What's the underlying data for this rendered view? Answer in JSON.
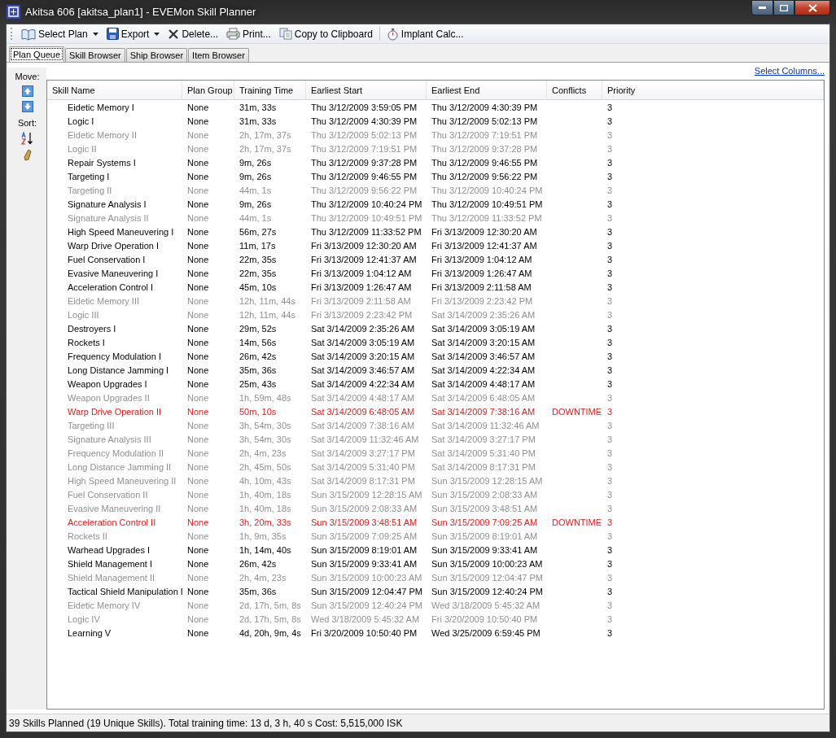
{
  "window": {
    "title": "Akitsa 606 [akitsa_plan1] - EVEMon Skill Planner"
  },
  "toolbar": [
    {
      "label": "Select Plan",
      "kind": "dropdown"
    },
    {
      "label": "Export",
      "kind": "dropdown"
    },
    {
      "label": "Delete...",
      "kind": "button"
    },
    {
      "label": "Print...",
      "kind": "button"
    },
    {
      "label": "Copy to Clipboard",
      "kind": "button"
    },
    {
      "label": "Implant Calc...",
      "kind": "button"
    }
  ],
  "tabs": [
    {
      "label": "Plan Queue",
      "selected": true
    },
    {
      "label": "Skill Browser",
      "selected": false
    },
    {
      "label": "Ship Browser",
      "selected": false
    },
    {
      "label": "Item Browser",
      "selected": false
    }
  ],
  "side_panel": {
    "move_label": "Move:",
    "sort_label": "Sort:"
  },
  "select_columns_link": "Select Columns...",
  "table": {
    "columns": [
      "Skill Name",
      "Plan Group",
      "Training Time",
      "Earliest Start",
      "Earliest End",
      "Conflicts",
      "Priority"
    ],
    "rows": [
      {
        "skill_name": "Eidetic Memory I",
        "plan_group": "None",
        "training_time": "31m, 33s",
        "earliest_start": "Thu 3/12/2009 3:59:05 PM",
        "earliest_end": "Thu 3/12/2009 4:30:39 PM",
        "priority": "3",
        "kind": "normal"
      },
      {
        "skill_name": "Logic I",
        "plan_group": "None",
        "training_time": "31m, 33s",
        "earliest_start": "Thu 3/12/2009 4:30:39 PM",
        "earliest_end": "Thu 3/12/2009 5:02:13 PM",
        "priority": "3",
        "kind": "normal"
      },
      {
        "skill_name": "Eidetic Memory II",
        "plan_group": "None",
        "training_time": "2h, 17m, 37s",
        "earliest_start": "Thu 3/12/2009 5:02:13 PM",
        "earliest_end": "Thu 3/12/2009 7:19:51 PM",
        "priority": "3",
        "kind": "dimmed"
      },
      {
        "skill_name": "Logic II",
        "plan_group": "None",
        "training_time": "2h, 17m, 37s",
        "earliest_start": "Thu 3/12/2009 7:19:51 PM",
        "earliest_end": "Thu 3/12/2009 9:37:28 PM",
        "priority": "3",
        "kind": "dimmed"
      },
      {
        "skill_name": "Repair Systems I",
        "plan_group": "None",
        "training_time": "9m, 26s",
        "earliest_start": "Thu 3/12/2009 9:37:28 PM",
        "earliest_end": "Thu 3/12/2009 9:46:55 PM",
        "priority": "3",
        "kind": "normal"
      },
      {
        "skill_name": "Targeting I",
        "plan_group": "None",
        "training_time": "9m, 26s",
        "earliest_start": "Thu 3/12/2009 9:46:55 PM",
        "earliest_end": "Thu 3/12/2009 9:56:22 PM",
        "priority": "3",
        "kind": "normal"
      },
      {
        "skill_name": "Targeting II",
        "plan_group": "None",
        "training_time": "44m, 1s",
        "earliest_start": "Thu 3/12/2009 9:56:22 PM",
        "earliest_end": "Thu 3/12/2009 10:40:24 PM",
        "priority": "3",
        "kind": "dimmed"
      },
      {
        "skill_name": "Signature Analysis I",
        "plan_group": "None",
        "training_time": "9m, 26s",
        "earliest_start": "Thu 3/12/2009 10:40:24 PM",
        "earliest_end": "Thu 3/12/2009 10:49:51 PM",
        "priority": "3",
        "kind": "normal"
      },
      {
        "skill_name": "Signature Analysis II",
        "plan_group": "None",
        "training_time": "44m, 1s",
        "earliest_start": "Thu 3/12/2009 10:49:51 PM",
        "earliest_end": "Thu 3/12/2009 11:33:52 PM",
        "priority": "3",
        "kind": "dimmed"
      },
      {
        "skill_name": "High Speed Maneuvering I",
        "plan_group": "None",
        "training_time": "56m, 27s",
        "earliest_start": "Thu 3/12/2009 11:33:52 PM",
        "earliest_end": "Fri 3/13/2009 12:30:20 AM",
        "priority": "3",
        "kind": "normal"
      },
      {
        "skill_name": "Warp Drive Operation I",
        "plan_group": "None",
        "training_time": "11m, 17s",
        "earliest_start": "Fri 3/13/2009 12:30:20 AM",
        "earliest_end": "Fri 3/13/2009 12:41:37 AM",
        "priority": "3",
        "kind": "normal"
      },
      {
        "skill_name": "Fuel Conservation I",
        "plan_group": "None",
        "training_time": "22m, 35s",
        "earliest_start": "Fri 3/13/2009 12:41:37 AM",
        "earliest_end": "Fri 3/13/2009 1:04:12 AM",
        "priority": "3",
        "kind": "normal"
      },
      {
        "skill_name": "Evasive Maneuvering I",
        "plan_group": "None",
        "training_time": "22m, 35s",
        "earliest_start": "Fri 3/13/2009 1:04:12 AM",
        "earliest_end": "Fri 3/13/2009 1:26:47 AM",
        "priority": "3",
        "kind": "normal"
      },
      {
        "skill_name": "Acceleration Control I",
        "plan_group": "None",
        "training_time": "45m, 10s",
        "earliest_start": "Fri 3/13/2009 1:26:47 AM",
        "earliest_end": "Fri 3/13/2009 2:11:58 AM",
        "priority": "3",
        "kind": "normal"
      },
      {
        "skill_name": "Eidetic Memory III",
        "plan_group": "None",
        "training_time": "12h, 11m, 44s",
        "earliest_start": "Fri 3/13/2009 2:11:58 AM",
        "earliest_end": "Fri 3/13/2009 2:23:42 PM",
        "priority": "3",
        "kind": "dimmed"
      },
      {
        "skill_name": "Logic III",
        "plan_group": "None",
        "training_time": "12h, 11m, 44s",
        "earliest_start": "Fri 3/13/2009 2:23:42 PM",
        "earliest_end": "Sat 3/14/2009 2:35:26 AM",
        "priority": "3",
        "kind": "dimmed"
      },
      {
        "skill_name": "Destroyers I",
        "plan_group": "None",
        "training_time": "29m, 52s",
        "earliest_start": "Sat 3/14/2009 2:35:26 AM",
        "earliest_end": "Sat 3/14/2009 3:05:19 AM",
        "priority": "3",
        "kind": "normal"
      },
      {
        "skill_name": "Rockets I",
        "plan_group": "None",
        "training_time": "14m, 56s",
        "earliest_start": "Sat 3/14/2009 3:05:19 AM",
        "earliest_end": "Sat 3/14/2009 3:20:15 AM",
        "priority": "3",
        "kind": "normal"
      },
      {
        "skill_name": "Frequency Modulation I",
        "plan_group": "None",
        "training_time": "26m, 42s",
        "earliest_start": "Sat 3/14/2009 3:20:15 AM",
        "earliest_end": "Sat 3/14/2009 3:46:57 AM",
        "priority": "3",
        "kind": "normal"
      },
      {
        "skill_name": "Long Distance Jamming I",
        "plan_group": "None",
        "training_time": "35m, 36s",
        "earliest_start": "Sat 3/14/2009 3:46:57 AM",
        "earliest_end": "Sat 3/14/2009 4:22:34 AM",
        "priority": "3",
        "kind": "normal"
      },
      {
        "skill_name": "Weapon Upgrades I",
        "plan_group": "None",
        "training_time": "25m, 43s",
        "earliest_start": "Sat 3/14/2009 4:22:34 AM",
        "earliest_end": "Sat 3/14/2009 4:48:17 AM",
        "priority": "3",
        "kind": "normal"
      },
      {
        "skill_name": "Weapon Upgrades II",
        "plan_group": "None",
        "training_time": "1h, 59m, 48s",
        "earliest_start": "Sat 3/14/2009 4:48:17 AM",
        "earliest_end": "Sat 3/14/2009 6:48:05 AM",
        "priority": "3",
        "kind": "dimmed"
      },
      {
        "skill_name": "Warp Drive Operation II",
        "plan_group": "None",
        "training_time": "50m, 10s",
        "earliest_start": "Sat 3/14/2009 6:48:05 AM",
        "earliest_end": "Sat 3/14/2009 7:38:16 AM",
        "conflicts": "DOWNTIME",
        "priority": "3",
        "kind": "conflict"
      },
      {
        "skill_name": "Targeting III",
        "plan_group": "None",
        "training_time": "3h, 54m, 30s",
        "earliest_start": "Sat 3/14/2009 7:38:16 AM",
        "earliest_end": "Sat 3/14/2009 11:32:46 AM",
        "priority": "3",
        "kind": "dimmed"
      },
      {
        "skill_name": "Signature Analysis III",
        "plan_group": "None",
        "training_time": "3h, 54m, 30s",
        "earliest_start": "Sat 3/14/2009 11:32:46 AM",
        "earliest_end": "Sat 3/14/2009 3:27:17 PM",
        "priority": "3",
        "kind": "dimmed"
      },
      {
        "skill_name": "Frequency Modulation II",
        "plan_group": "None",
        "training_time": "2h, 4m, 23s",
        "earliest_start": "Sat 3/14/2009 3:27:17 PM",
        "earliest_end": "Sat 3/14/2009 5:31:40 PM",
        "priority": "3",
        "kind": "dimmed"
      },
      {
        "skill_name": "Long Distance Jamming II",
        "plan_group": "None",
        "training_time": "2h, 45m, 50s",
        "earliest_start": "Sat 3/14/2009 5:31:40 PM",
        "earliest_end": "Sat 3/14/2009 8:17:31 PM",
        "priority": "3",
        "kind": "dimmed"
      },
      {
        "skill_name": "High Speed Maneuvering II",
        "plan_group": "None",
        "training_time": "4h, 10m, 43s",
        "earliest_start": "Sat 3/14/2009 8:17:31 PM",
        "earliest_end": "Sun 3/15/2009 12:28:15 AM",
        "priority": "3",
        "kind": "dimmed"
      },
      {
        "skill_name": "Fuel Conservation II",
        "plan_group": "None",
        "training_time": "1h, 40m, 18s",
        "earliest_start": "Sun 3/15/2009 12:28:15 AM",
        "earliest_end": "Sun 3/15/2009 2:08:33 AM",
        "priority": "3",
        "kind": "dimmed"
      },
      {
        "skill_name": "Evasive Maneuvering II",
        "plan_group": "None",
        "training_time": "1h, 40m, 18s",
        "earliest_start": "Sun 3/15/2009 2:08:33 AM",
        "earliest_end": "Sun 3/15/2009 3:48:51 AM",
        "priority": "3",
        "kind": "dimmed"
      },
      {
        "skill_name": "Acceleration Control II",
        "plan_group": "None",
        "training_time": "3h, 20m, 33s",
        "earliest_start": "Sun 3/15/2009 3:48:51 AM",
        "earliest_end": "Sun 3/15/2009 7:09:25 AM",
        "conflicts": "DOWNTIME",
        "priority": "3",
        "kind": "conflict"
      },
      {
        "skill_name": "Rockets II",
        "plan_group": "None",
        "training_time": "1h, 9m, 35s",
        "earliest_start": "Sun 3/15/2009 7:09:25 AM",
        "earliest_end": "Sun 3/15/2009 8:19:01 AM",
        "priority": "3",
        "kind": "dimmed"
      },
      {
        "skill_name": "Warhead Upgrades I",
        "plan_group": "None",
        "training_time": "1h, 14m, 40s",
        "earliest_start": "Sun 3/15/2009 8:19:01 AM",
        "earliest_end": "Sun 3/15/2009 9:33:41 AM",
        "priority": "3",
        "kind": "normal"
      },
      {
        "skill_name": "Shield Management I",
        "plan_group": "None",
        "training_time": "26m, 42s",
        "earliest_start": "Sun 3/15/2009 9:33:41 AM",
        "earliest_end": "Sun 3/15/2009 10:00:23 AM",
        "priority": "3",
        "kind": "normal"
      },
      {
        "skill_name": "Shield Management II",
        "plan_group": "None",
        "training_time": "2h, 4m, 23s",
        "earliest_start": "Sun 3/15/2009 10:00:23 AM",
        "earliest_end": "Sun 3/15/2009 12:04:47 PM",
        "priority": "3",
        "kind": "dimmed"
      },
      {
        "skill_name": "Tactical Shield Manipulation I",
        "plan_group": "None",
        "training_time": "35m, 36s",
        "earliest_start": "Sun 3/15/2009 12:04:47 PM",
        "earliest_end": "Sun 3/15/2009 12:40:24 PM",
        "priority": "3",
        "kind": "normal"
      },
      {
        "skill_name": "Eidetic Memory IV",
        "plan_group": "None",
        "training_time": "2d, 17h, 5m, 8s",
        "earliest_start": "Sun 3/15/2009 12:40:24 PM",
        "earliest_end": "Wed 3/18/2009 5:45:32 AM",
        "priority": "3",
        "kind": "dimmed"
      },
      {
        "skill_name": "Logic IV",
        "plan_group": "None",
        "training_time": "2d, 17h, 5m, 8s",
        "earliest_start": "Wed 3/18/2009 5:45:32 AM",
        "earliest_end": "Fri 3/20/2009 10:50:40 PM",
        "priority": "3",
        "kind": "dimmed"
      },
      {
        "skill_name": "Learning V",
        "plan_group": "None",
        "training_time": "4d, 20h, 9m, 4s",
        "earliest_start": "Fri 3/20/2009 10:50:40 PM",
        "earliest_end": "Wed 3/25/2009 6:59:45 PM",
        "priority": "3",
        "kind": "normal"
      }
    ]
  },
  "status_bar": "39 Skills Planned (19 Unique Skills). Total training time: 13 d, 3 h, 40 s Cost: 5,515,000 ISK"
}
